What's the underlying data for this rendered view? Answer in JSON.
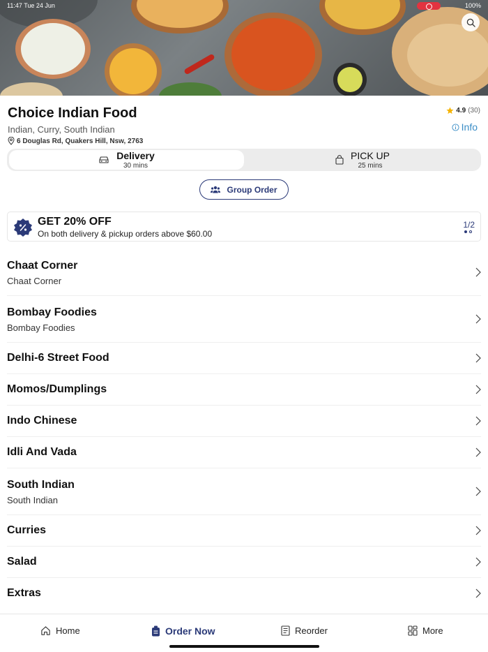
{
  "status_bar": {
    "time": "11:47  Tue 24 Jun",
    "battery": "100%"
  },
  "restaurant": {
    "name": "Choice Indian Food",
    "cuisine": "Indian, Curry, South Indian",
    "address": "6 Douglas Rd, Quakers Hill, Nsw, 2763",
    "rating": "4.9",
    "rating_count": "(30)",
    "info_label": "Info"
  },
  "modes": {
    "delivery": {
      "label": "Delivery",
      "time": "30 mins",
      "selected": true
    },
    "pickup": {
      "label": "PICK UP",
      "time": "25 mins",
      "selected": false
    }
  },
  "group_order_label": "Group Order",
  "promo": {
    "title": "GET 20% OFF",
    "subtitle": "On both delivery & pickup orders above $60.00",
    "page": "1/2"
  },
  "categories": [
    {
      "title": "Chaat Corner",
      "subtitle": "Chaat Corner"
    },
    {
      "title": "Bombay Foodies",
      "subtitle": "Bombay Foodies"
    },
    {
      "title": "Delhi-6 Street Food",
      "subtitle": ""
    },
    {
      "title": "Momos/Dumplings",
      "subtitle": ""
    },
    {
      "title": "Indo Chinese",
      "subtitle": ""
    },
    {
      "title": "Idli And Vada",
      "subtitle": ""
    },
    {
      "title": "South Indian",
      "subtitle": "South Indian"
    },
    {
      "title": "Curries",
      "subtitle": ""
    },
    {
      "title": "Salad",
      "subtitle": ""
    },
    {
      "title": "Extras",
      "subtitle": ""
    }
  ],
  "nav": {
    "home": "Home",
    "order_now": "Order Now",
    "reorder": "Reorder",
    "more": "More"
  },
  "colors": {
    "accent": "#2b3a78",
    "info": "#3a8dc6",
    "star": "#f5b301",
    "record": "#e33340"
  }
}
